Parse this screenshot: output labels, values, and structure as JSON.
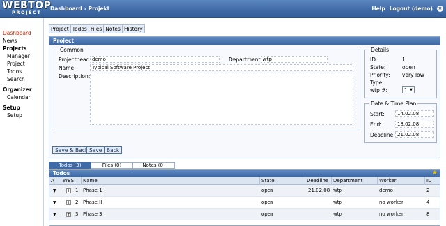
{
  "header": {
    "logo_main": "WEBTOP",
    "logo_sub": "PROJECT",
    "breadcrumb": [
      "Dashboard",
      "Projekt"
    ],
    "help": "Help",
    "logout": "Logout (demo)"
  },
  "sidebar": {
    "items": [
      {
        "label": "Dashboard"
      },
      {
        "label": "News"
      },
      {
        "label": "Projects"
      },
      {
        "label": "Manager"
      },
      {
        "label": "Project"
      },
      {
        "label": "Todos"
      },
      {
        "label": "Search"
      },
      {
        "label": "Organizer"
      },
      {
        "label": "Calendar"
      },
      {
        "label": "Setup"
      },
      {
        "label": "Setup"
      }
    ]
  },
  "tabs": [
    "Project",
    "Todos",
    "Files",
    "Notes",
    "History"
  ],
  "project_panel": {
    "title": "Project",
    "common": {
      "legend": "Common",
      "projecthead_label": "Projecthead:",
      "projecthead_value": "demo",
      "department_label": "Department:",
      "department_value": "wtp",
      "name_label": "Name:",
      "name_value": "Typical Software Project",
      "description_label": "Description:",
      "description_value": ""
    },
    "details": {
      "legend": "Details",
      "id_label": "ID:",
      "id_value": "1",
      "state_label": "State:",
      "state_value": "open",
      "priority_label": "Priority:",
      "priority_value": "very low",
      "type_label": "Type:",
      "type_value": "",
      "wtp_label": "wtp #:",
      "wtp_value": "1"
    },
    "dates": {
      "legend": "Date & Time Plan",
      "start_label": "Start:",
      "start_value": "14.02.08",
      "end_label": "End:",
      "end_value": "18.02.08",
      "deadline_label": "Deadline:",
      "deadline_value": "21.02.08"
    },
    "buttons": {
      "save_back": "Save & Back",
      "save": "Save",
      "back": "Back"
    }
  },
  "bottom_tabs": [
    "Todos (3)",
    "Files (0)",
    "Notes (0)"
  ],
  "todos": {
    "title": "Todos",
    "columns": [
      "A",
      "WBS",
      "Name",
      "State",
      "Deadline",
      "Department",
      "Worker",
      "ID"
    ],
    "rows": [
      {
        "num": "1",
        "name": "Phase 1",
        "state": "open",
        "deadline": "21.02.08",
        "department": "wtp",
        "worker": "demo",
        "id": "2"
      },
      {
        "num": "2",
        "name": "Phase II",
        "state": "open",
        "deadline": "",
        "department": "wtp",
        "worker": "no worker",
        "id": "4"
      },
      {
        "num": "3",
        "name": "Phase 3",
        "state": "open",
        "deadline": "",
        "department": "wtp",
        "worker": "no worker",
        "id": "8"
      }
    ]
  },
  "colors": {
    "header_blue": "#3f6aa6",
    "active_red": "#cc2200",
    "star": "#f2c200"
  }
}
